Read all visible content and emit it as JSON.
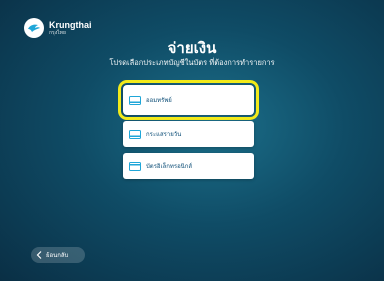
{
  "brand": {
    "name": "Krungthai",
    "sub": "กรุงไทย",
    "logo_icon": "krungthai-bird-logo"
  },
  "header": {
    "title": "จ่ายเงิน",
    "subtitle": "โปรดเลือกประเภทบัญชีในบัตร ที่ต้องการทำรายการ"
  },
  "options": [
    {
      "label": "ออมทรัพย์",
      "icon": "savings-card-icon",
      "selected": true
    },
    {
      "label": "กระแสรายวัน",
      "icon": "current-account-card-icon",
      "selected": false
    },
    {
      "label": "บัตรอิเล็กทรอนิกส์",
      "icon": "electronic-card-icon",
      "selected": false
    }
  ],
  "back_button": {
    "label": "ย้อนกลับ",
    "icon": "chevron-left-icon"
  },
  "colors": {
    "background": "#0f4c66",
    "highlight": "#f2ea1a",
    "option_text": "#0e4f78",
    "icon_accent": "#1fa6d8"
  }
}
